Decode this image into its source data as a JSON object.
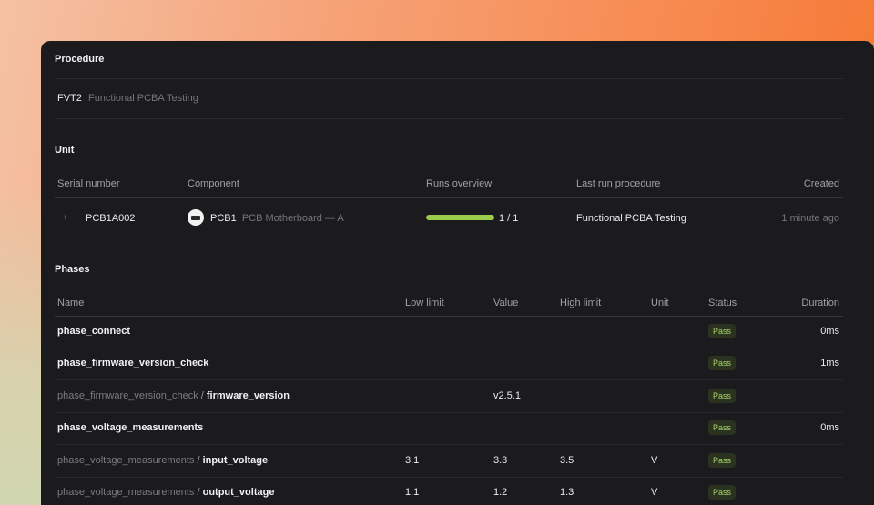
{
  "procedure": {
    "title": "Procedure",
    "code": "FVT2",
    "name": "Functional PCBA Testing"
  },
  "unit": {
    "title": "Unit",
    "headers": {
      "serial": "Serial number",
      "component": "Component",
      "runs": "Runs overview",
      "last_run": "Last run procedure",
      "created": "Created"
    },
    "row": {
      "serial": "PCB1A002",
      "component_code": "PCB1",
      "component_name": "PCB Motherboard — A",
      "runs_text": "1 / 1",
      "runs_fraction": 1.0,
      "last_run": "Functional PCBA Testing",
      "created": "1 minute ago"
    },
    "runs_bar_color": "#9ccd4a"
  },
  "phases": {
    "title": "Phases",
    "headers": {
      "name": "Name",
      "low": "Low limit",
      "value": "Value",
      "high": "High limit",
      "unit": "Unit",
      "status": "Status",
      "duration": "Duration"
    },
    "rows": [
      {
        "name": "phase_connect",
        "low": "",
        "value": "",
        "high": "",
        "unit": "",
        "status": "Pass",
        "duration": "0ms"
      },
      {
        "name": "phase_firmware_version_check",
        "low": "",
        "value": "",
        "high": "",
        "unit": "",
        "status": "Pass",
        "duration": "1ms"
      },
      {
        "prefix": "phase_firmware_version_check",
        "name": "firmware_version",
        "low": "",
        "value": "v2.5.1",
        "high": "",
        "unit": "",
        "status": "Pass",
        "duration": ""
      },
      {
        "name": "phase_voltage_measurements",
        "low": "",
        "value": "",
        "high": "",
        "unit": "",
        "status": "Pass",
        "duration": "0ms"
      },
      {
        "prefix": "phase_voltage_measurements",
        "name": "input_voltage",
        "low": "3.1",
        "value": "3.3",
        "high": "3.5",
        "unit": "V",
        "status": "Pass",
        "duration": ""
      },
      {
        "prefix": "phase_voltage_measurements",
        "name": "output_voltage",
        "low": "1.1",
        "value": "1.2",
        "high": "1.3",
        "unit": "V",
        "status": "Pass",
        "duration": ""
      }
    ],
    "status_color": "#a9d36a"
  }
}
